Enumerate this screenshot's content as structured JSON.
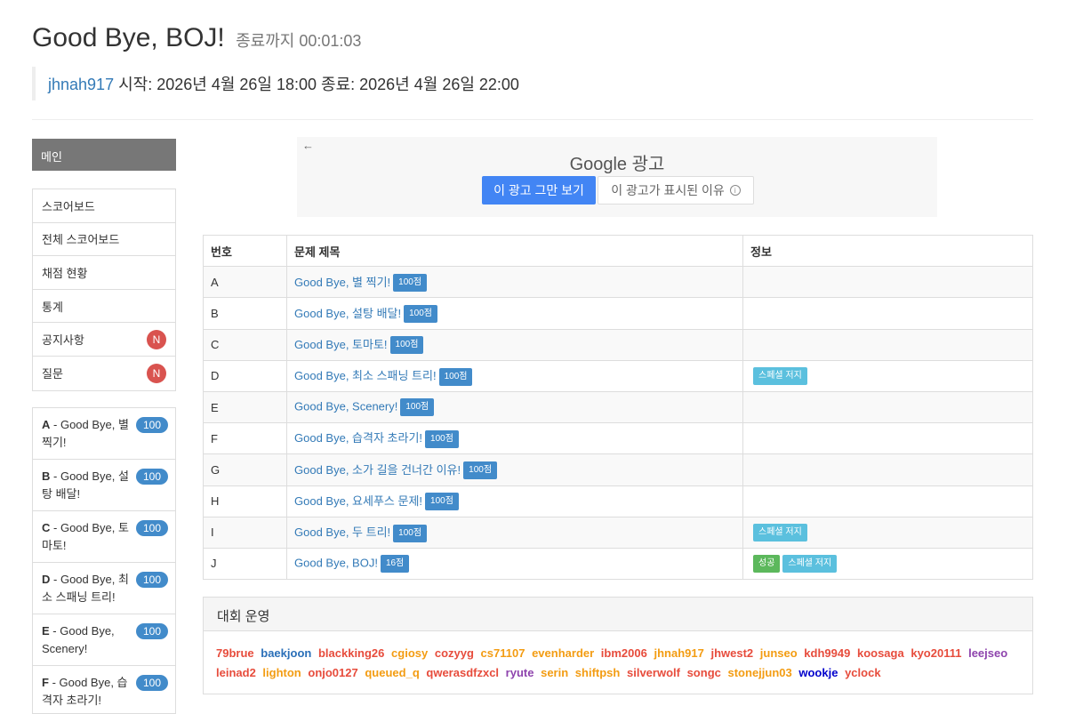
{
  "header": {
    "title": "Good Bye, BOJ!",
    "countdown": "종료까지 00:01:03",
    "user": "jhnah917",
    "time_info": "시작: 2026년 4월 26일 18:00 종료: 2026년 4월 26일 22:00"
  },
  "sidebar": {
    "main_label": "메인",
    "menu": [
      {
        "label": "스코어보드"
      },
      {
        "label": "전체 스코어보드"
      },
      {
        "label": "채점 현황"
      },
      {
        "label": "통계"
      },
      {
        "label": "공지사항",
        "badge": "N"
      },
      {
        "label": "질문",
        "badge": "N"
      }
    ],
    "problems": [
      {
        "id": "A",
        "title": "Good Bye, 별 찍기!",
        "score": "100"
      },
      {
        "id": "B",
        "title": "Good Bye, 설탕 배달!",
        "score": "100"
      },
      {
        "id": "C",
        "title": "Good Bye, 토마토!",
        "score": "100"
      },
      {
        "id": "D",
        "title": "Good Bye, 최소 스패닝 트리!",
        "score": "100"
      },
      {
        "id": "E",
        "title": "Good Bye, Scenery!",
        "score": "100"
      },
      {
        "id": "F",
        "title": "Good Bye, 습격자 초라기!",
        "score": "100"
      }
    ]
  },
  "ad": {
    "back_icon": "←",
    "google_label": "Google 광고",
    "stop_button": "이 광고 그만 보기",
    "why_button": "이 광고가 표시된 이유",
    "info_icon": "i"
  },
  "table": {
    "headers": [
      "번호",
      "문제 제목",
      "정보"
    ],
    "rows": [
      {
        "num": "A",
        "title": "Good Bye, 별 찍기!",
        "score": "100점",
        "info": []
      },
      {
        "num": "B",
        "title": "Good Bye, 설탕 배달!",
        "score": "100점",
        "info": []
      },
      {
        "num": "C",
        "title": "Good Bye, 토마토!",
        "score": "100점",
        "info": []
      },
      {
        "num": "D",
        "title": "Good Bye, 최소 스패닝 트리!",
        "score": "100점",
        "info": [
          {
            "text": "스페셜 저지",
            "type": "info"
          }
        ]
      },
      {
        "num": "E",
        "title": "Good Bye, Scenery!",
        "score": "100점",
        "info": []
      },
      {
        "num": "F",
        "title": "Good Bye, 습격자 초라기!",
        "score": "100점",
        "info": []
      },
      {
        "num": "G",
        "title": "Good Bye, 소가 길을 건너간 이유!",
        "score": "100점",
        "info": []
      },
      {
        "num": "H",
        "title": "Good Bye, 요세푸스 문제!",
        "score": "100점",
        "info": []
      },
      {
        "num": "I",
        "title": "Good Bye, 두 트리!",
        "score": "100점",
        "info": [
          {
            "text": "스페셜 저지",
            "type": "info"
          }
        ]
      },
      {
        "num": "J",
        "title": "Good Bye, BOJ!",
        "score": "16점",
        "info": [
          {
            "text": "성공",
            "type": "success"
          },
          {
            "text": "스페셜 저지",
            "type": "info"
          }
        ]
      }
    ]
  },
  "staff": {
    "heading": "대회 운영",
    "users": [
      {
        "name": "79brue",
        "color": "#e74c3c"
      },
      {
        "name": "baekjoon",
        "color": "#2a6fb8"
      },
      {
        "name": "blackking26",
        "color": "#e74c3c"
      },
      {
        "name": "cgiosy",
        "color": "#f39c12"
      },
      {
        "name": "cozyyg",
        "color": "#e74c3c"
      },
      {
        "name": "cs71107",
        "color": "#f39c12"
      },
      {
        "name": "evenharder",
        "color": "#f39c12"
      },
      {
        "name": "ibm2006",
        "color": "#e74c3c"
      },
      {
        "name": "jhnah917",
        "color": "#f39c12"
      },
      {
        "name": "jhwest2",
        "color": "#e74c3c"
      },
      {
        "name": "junseo",
        "color": "#f39c12"
      },
      {
        "name": "kdh9949",
        "color": "#e74c3c"
      },
      {
        "name": "koosaga",
        "color": "#e74c3c"
      },
      {
        "name": "kyo20111",
        "color": "#e74c3c"
      },
      {
        "name": "leejseo",
        "color": "#8e44ad"
      },
      {
        "name": "leinad2",
        "color": "#e74c3c"
      },
      {
        "name": "lighton",
        "color": "#f39c12"
      },
      {
        "name": "onjo0127",
        "color": "#e74c3c"
      },
      {
        "name": "queued_q",
        "color": "#f39c12"
      },
      {
        "name": "qwerasdfzxcl",
        "color": "#e74c3c"
      },
      {
        "name": "ryute",
        "color": "#8e44ad"
      },
      {
        "name": "serin",
        "color": "#f39c12"
      },
      {
        "name": "shiftpsh",
        "color": "#f39c12"
      },
      {
        "name": "silverwolf",
        "color": "#e74c3c"
      },
      {
        "name": "songc",
        "color": "#e74c3c"
      },
      {
        "name": "stonejjun03",
        "color": "#f39c12"
      },
      {
        "name": "wookje",
        "color": "#0000cc"
      },
      {
        "name": "yclock",
        "color": "#e74c3c"
      }
    ]
  }
}
